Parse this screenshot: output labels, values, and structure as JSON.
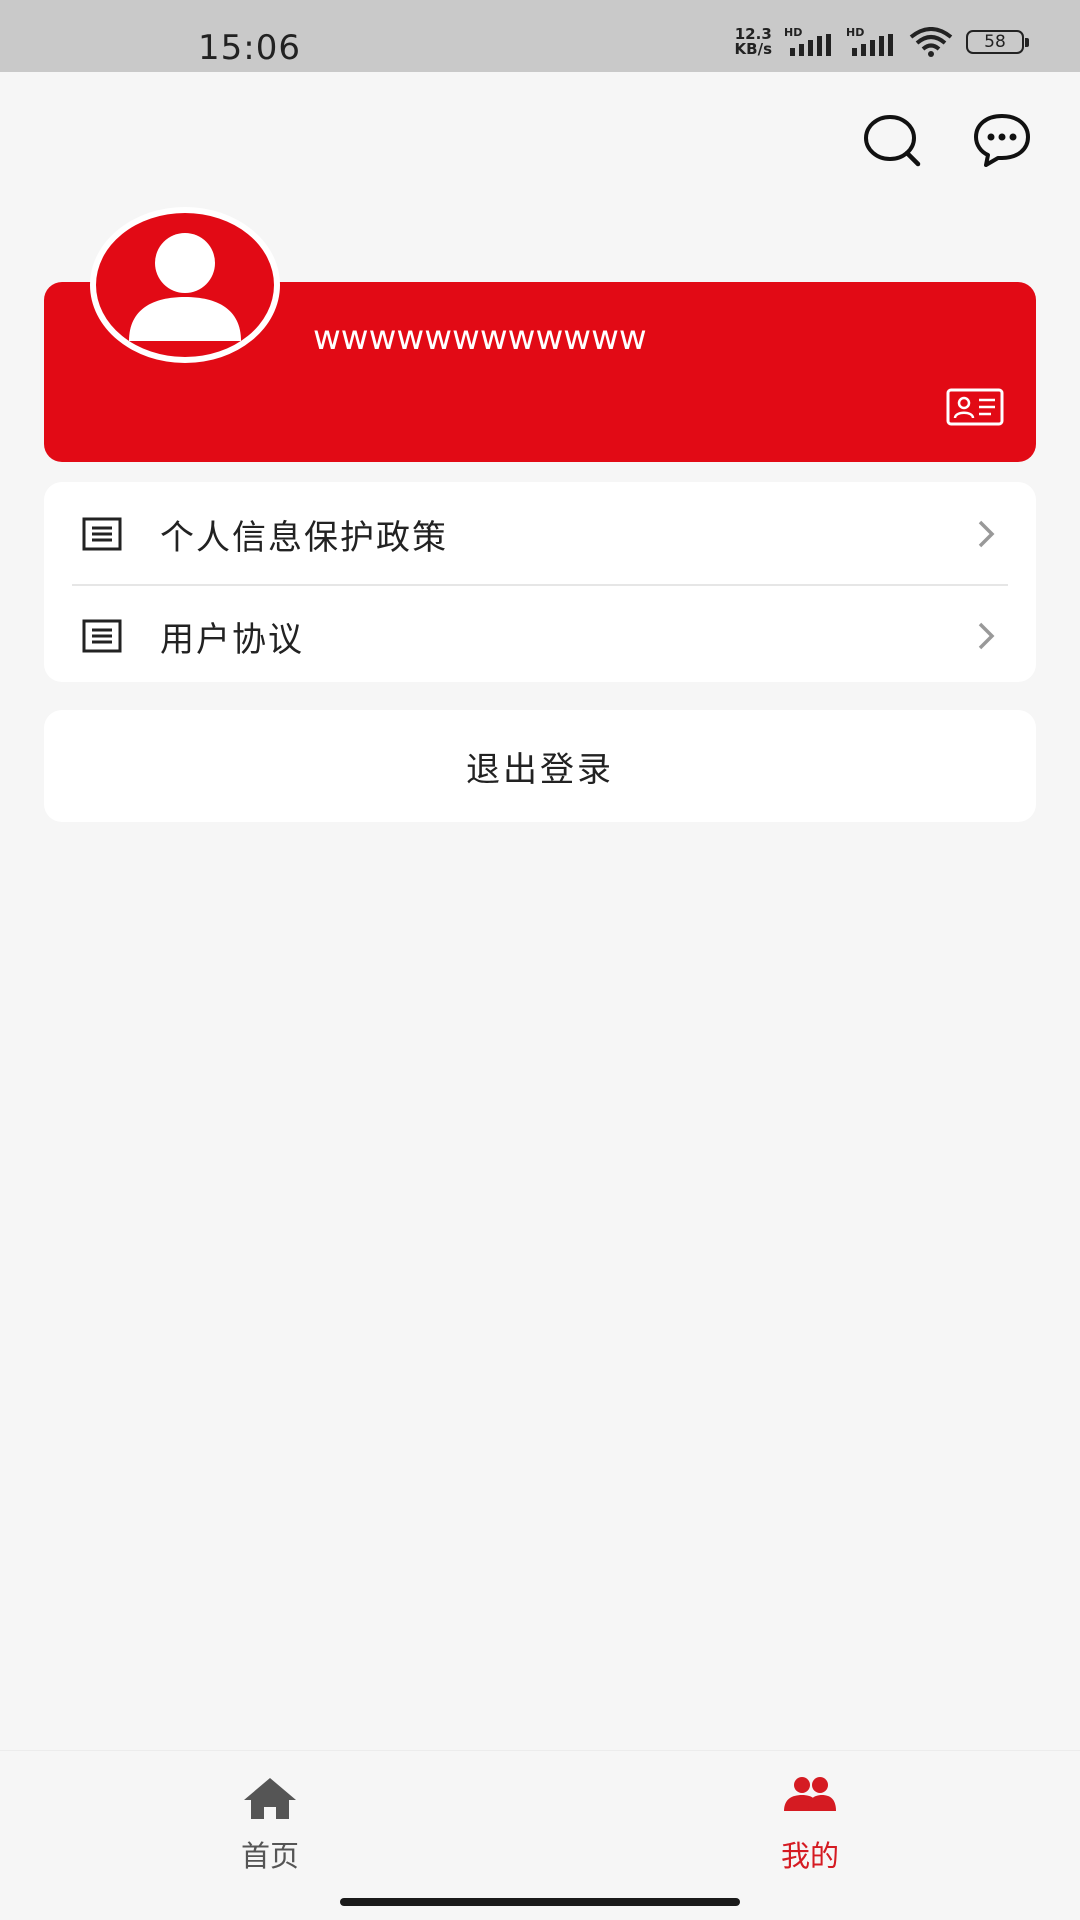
{
  "status_bar": {
    "time": "15:06",
    "net_speed_value": "12.3",
    "net_speed_unit": "KB/s",
    "signal_1_label": "HD",
    "signal_2_label": "HD",
    "battery_level": "58",
    "icons": [
      "net-speed",
      "signal-icon",
      "signal-icon",
      "wifi-icon",
      "battery-icon"
    ]
  },
  "header": {
    "icons": [
      "search-icon",
      "chat-bubble-icon"
    ]
  },
  "profile": {
    "username": "wwwwwwwwwwww",
    "avatar_icon": "user-avatar-icon",
    "id_card_icon": "id-card-icon"
  },
  "menu": {
    "items": [
      {
        "label": "个人信息保护政策",
        "icon": "document-icon"
      },
      {
        "label": "用户协议",
        "icon": "document-icon"
      }
    ]
  },
  "logout": {
    "label": "退出登录"
  },
  "bottom_nav": {
    "items": [
      {
        "label": "首页",
        "icon": "home-icon",
        "active": false
      },
      {
        "label": "我的",
        "icon": "users-icon",
        "active": true
      }
    ]
  },
  "colors": {
    "brand_red": "#e20a15",
    "active_tab": "#d51b22",
    "inactive_tab": "#555555",
    "background": "#f6f6f6"
  }
}
